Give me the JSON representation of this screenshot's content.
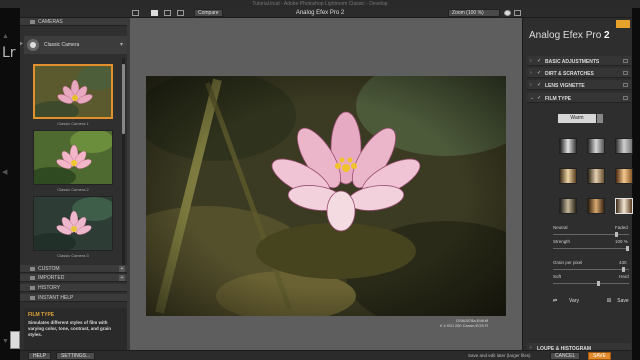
{
  "host": {
    "window_title": "Tutorial.lrcat - Adobe Photoshop Lightroom Classic - Develop",
    "logo": "Lr"
  },
  "app": {
    "title": "Analog Efex Pro 2",
    "brand": "Analog Efex Pro",
    "brand_version": "2",
    "compare_label": "Compare",
    "zoom_label": "Zoom (100 %)"
  },
  "left_panel": {
    "cameras_header": "CAMERAS",
    "preset_group": "Classic Camera",
    "presets": [
      {
        "caption": "Classic Camera 1",
        "selected": true
      },
      {
        "caption": "Classic Camera 2",
        "selected": false
      },
      {
        "caption": "Classic Camera 3",
        "selected": false
      }
    ],
    "sections": [
      {
        "label": "CUSTOM",
        "icon": "custom-icon"
      },
      {
        "label": "IMPORTED",
        "icon": "imported-icon"
      },
      {
        "label": "HISTORY",
        "icon": "history-icon"
      },
      {
        "label": "INSTANT HELP",
        "icon": "help-icon"
      }
    ],
    "help": {
      "heading": "FILM TYPE",
      "text": "Simulates different styles of film with varying color, tone, contrast, and grain styles."
    }
  },
  "canvas": {
    "file_name": "DSA0578a-Edit.tif",
    "file_meta": "f/ 4 ISO 200 Canon EOS R"
  },
  "right_panel": {
    "sections": [
      {
        "label": "BASIC ADJUSTMENTS",
        "expanded": false
      },
      {
        "label": "DIRT & SCRATCHES",
        "expanded": false
      },
      {
        "label": "LENS VIGNETTE",
        "expanded": false
      },
      {
        "label": "FILM TYPE",
        "expanded": true
      }
    ],
    "film_type": {
      "dropdown_value": "Warm",
      "neutral_label": "Neutral",
      "faded_label": "Faded",
      "strength_label": "Strength",
      "strength_value": "100 %",
      "grain_label": "Grain per pixel",
      "grain_value": "430",
      "soft_label": "Soft",
      "hard_label": "Hard",
      "vary_label": "Vary",
      "save_label": "Save",
      "neutral_faded_level": 0.85,
      "strength_level": 1.0,
      "grain_level": 0.95,
      "soft_hard_level": 0.6
    },
    "bottom_section": "LOUPE & HISTOGRAM"
  },
  "bottom_bar": {
    "help_label": "HELP",
    "settings_label": "SETTINGS...",
    "info_text": "Save and edit later (larger files)",
    "cancel_label": "CANCEL",
    "save_label": "SAVE"
  },
  "colors": {
    "accent": "#e08a2a",
    "help_heading": "#e0a43a"
  }
}
